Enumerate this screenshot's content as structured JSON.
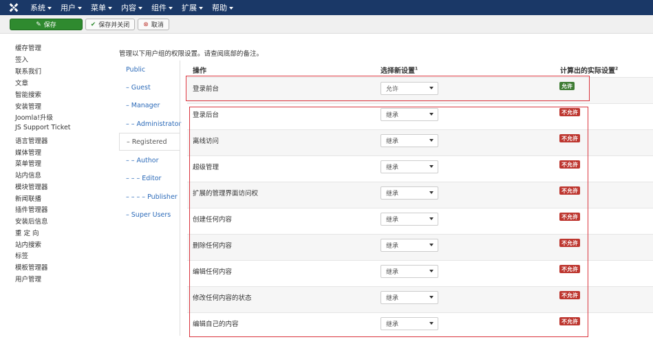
{
  "topbar": {
    "menu": [
      "系统",
      "用户",
      "菜单",
      "内容",
      "组件",
      "扩展",
      "帮助"
    ]
  },
  "toolbar": {
    "save_label": "保存",
    "save_close_label": "保存并关闭",
    "cancel_label": "取消"
  },
  "sidebar": {
    "items": [
      "缓存管理",
      "签入",
      "联系我们",
      "文章",
      "智能搜索",
      "安装管理",
      "Joomla!升级",
      "JS Support Ticket",
      "语言管理器",
      "媒体管理",
      "菜单管理",
      "站内信息",
      "模块管理器",
      "新闻联播",
      "插件管理器",
      "安装后信息",
      "重 定 向",
      "站内搜索",
      "标签",
      "模板管理器",
      "用户管理"
    ]
  },
  "intro": "管理以下用户组的权限设置。请查阅底部的备注。",
  "groups": [
    "Public",
    "– Guest",
    "– Manager",
    "– – Administrator",
    "– Registered",
    "– – Author",
    "– – – Editor",
    "– – – – Publisher",
    "– Super Users"
  ],
  "active_group_index": 4,
  "table": {
    "col_action": "操作",
    "col_new_setting": "选择新设置",
    "col_new_setting_note": "1",
    "col_calculated": "计算出的实际设置",
    "col_calculated_note": "2",
    "rows": [
      {
        "action": "登录前台",
        "setting": "允许",
        "calculated": "允许",
        "status": "allow"
      },
      {
        "action": "登录后台",
        "setting": "继承",
        "calculated": "不允许",
        "status": "deny"
      },
      {
        "action": "离线访问",
        "setting": "继承",
        "calculated": "不允许",
        "status": "deny"
      },
      {
        "action": "超级管理",
        "setting": "继承",
        "calculated": "不允许",
        "status": "deny"
      },
      {
        "action": "扩展的管理界面访问权",
        "setting": "继承",
        "calculated": "不允许",
        "status": "deny"
      },
      {
        "action": "创建任何内容",
        "setting": "继承",
        "calculated": "不允许",
        "status": "deny"
      },
      {
        "action": "删除任何内容",
        "setting": "继承",
        "calculated": "不允许",
        "status": "deny"
      },
      {
        "action": "编辑任何内容",
        "setting": "继承",
        "calculated": "不允许",
        "status": "deny"
      },
      {
        "action": "修改任何内容的状态",
        "setting": "继承",
        "calculated": "不允许",
        "status": "deny"
      },
      {
        "action": "编辑自己的内容",
        "setting": "继承",
        "calculated": "不允许",
        "status": "deny"
      }
    ]
  },
  "colors": {
    "topbar": "#1a3867",
    "save_button": "#2f8a2f",
    "allow_badge": "#3f7c34",
    "deny_badge": "#bd362f",
    "highlight_box": "#d9323b",
    "link": "#2a69b8"
  }
}
